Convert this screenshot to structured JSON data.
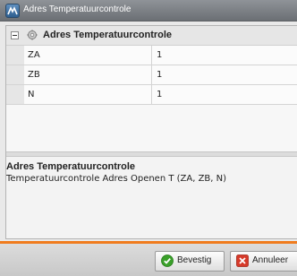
{
  "window": {
    "title": "Adres Temperatuurcontrole"
  },
  "grid": {
    "category": "Adres Temperatuurcontrole",
    "rows": [
      {
        "name": "ZA",
        "value": "1"
      },
      {
        "name": "ZB",
        "value": "1"
      },
      {
        "name": "N",
        "value": "1"
      }
    ]
  },
  "description": {
    "title": "Adres Temperatuurcontrole",
    "text": "Temperatuurcontrole Adres Openen T (ZA, ZB, N)"
  },
  "buttons": {
    "confirm_label": "Bevestig",
    "cancel_label": "Annuleer"
  },
  "colors": {
    "accent": "#f07c1e",
    "titlebar": "#7a7e83",
    "confirm_icon": "#3aa02a",
    "cancel_icon": "#d63a2a"
  }
}
